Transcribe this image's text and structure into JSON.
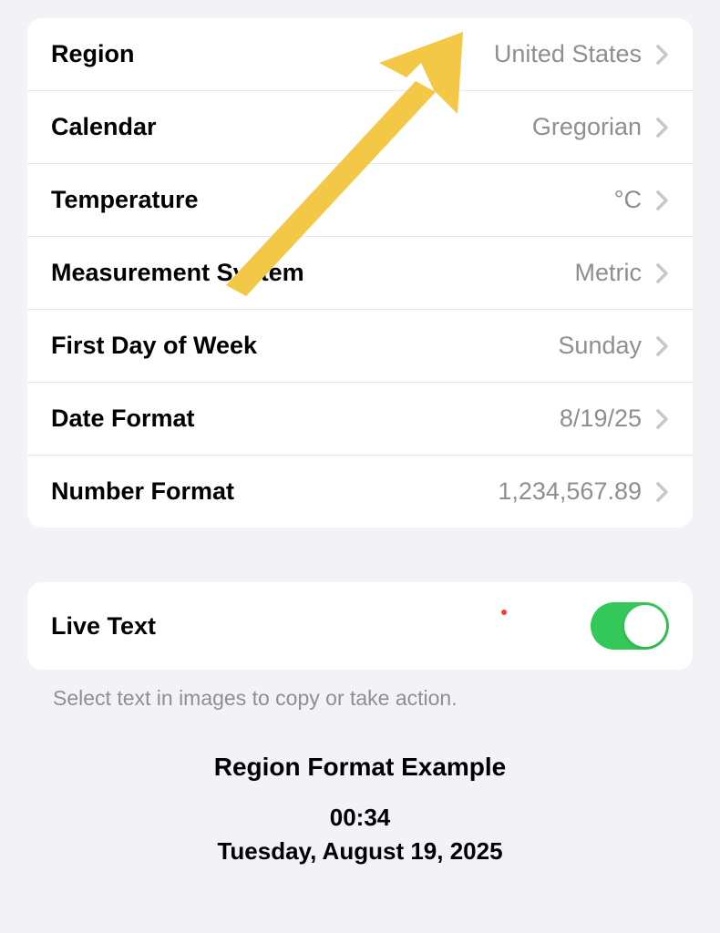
{
  "settings": {
    "rows": [
      {
        "label": "Region",
        "value": "United States"
      },
      {
        "label": "Calendar",
        "value": "Gregorian"
      },
      {
        "label": "Temperature",
        "value": "°C"
      },
      {
        "label": "Measurement System",
        "value": "Metric"
      },
      {
        "label": "First Day of Week",
        "value": "Sunday"
      },
      {
        "label": "Date Format",
        "value": "8/19/25"
      },
      {
        "label": "Number Format",
        "value": "1,234,567.89"
      }
    ]
  },
  "liveText": {
    "label": "Live Text",
    "enabled": true,
    "footer": "Select text in images to copy or take action."
  },
  "example": {
    "title": "Region Format Example",
    "time": "00:34",
    "date": "Tuesday, August 19, 2025"
  },
  "colors": {
    "toggleOn": "#34c759",
    "arrow": "#f2c94c"
  }
}
